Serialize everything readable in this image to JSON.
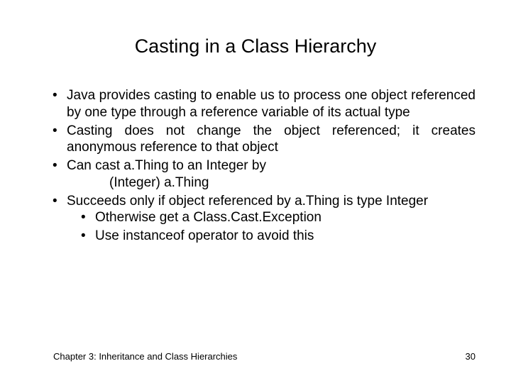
{
  "slide": {
    "title": "Casting in a Class Hierarchy",
    "bullets": {
      "b1": "Java provides casting to enable us to process one object referenced by one type through a reference variable of its actual type",
      "b2": "Casting does not change the object referenced; it creates anonymous reference to that object",
      "b3": "Can cast a.Thing to an Integer by",
      "b3_code": "(Integer) a.Thing",
      "b4": "Succeeds only if object referenced by a.Thing is type Integer",
      "b4_sub1": "Otherwise get a Class.Cast.Exception",
      "b4_sub2": "Use instanceof operator to avoid this"
    },
    "footer_left": "Chapter 3: Inheritance and Class Hierarchies",
    "footer_right": "30"
  }
}
